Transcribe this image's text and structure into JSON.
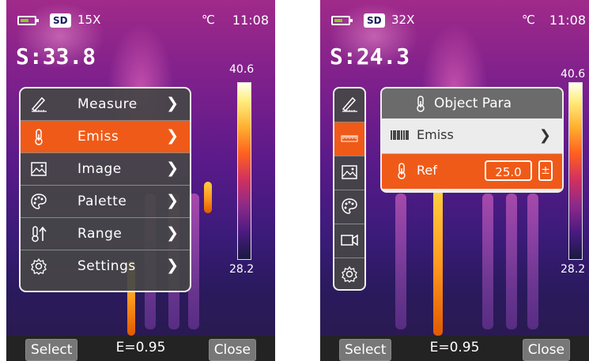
{
  "left": {
    "status": {
      "sd_label": "SD",
      "zoom": "15X",
      "unit": "℃",
      "time": "11:08"
    },
    "spot_temp": "S:33.8",
    "scale": {
      "max": "40.6",
      "min": "28.2"
    },
    "menu": [
      {
        "label": "Measure",
        "icon": "ruler-pencil-icon",
        "active": false
      },
      {
        "label": "Emiss",
        "icon": "thermometer-icon",
        "active": true
      },
      {
        "label": "Image",
        "icon": "image-icon",
        "active": false
      },
      {
        "label": "Palette",
        "icon": "palette-icon",
        "active": false
      },
      {
        "label": "Range",
        "icon": "thermometer-range-icon",
        "active": false
      },
      {
        "label": "Settings",
        "icon": "gear-icon",
        "active": false
      }
    ],
    "bottom": {
      "select": "Select",
      "emissivity": "E=0.95",
      "close": "Close"
    }
  },
  "right": {
    "status": {
      "sd_label": "SD",
      "zoom": "32X",
      "unit": "℃",
      "time": "11:08"
    },
    "spot_temp": "S:24.3",
    "scale": {
      "max": "40.6",
      "min": "28.2"
    },
    "iconbar": [
      "ruler-pencil-icon",
      "emissivity-scale-icon",
      "image-icon",
      "palette-icon",
      "video-camera-icon",
      "gear-icon"
    ],
    "submenu": {
      "title": "Object Para",
      "emiss_label": "Emiss",
      "ref_label": "Ref",
      "ref_value": "25.0",
      "adjust_symbol": "±"
    },
    "bottom": {
      "select": "Select",
      "emissivity": "E=0.95",
      "close": "Close"
    }
  },
  "colors": {
    "accent": "#f05a18",
    "menu_bg": "#464646",
    "battery": "#7bd320"
  }
}
